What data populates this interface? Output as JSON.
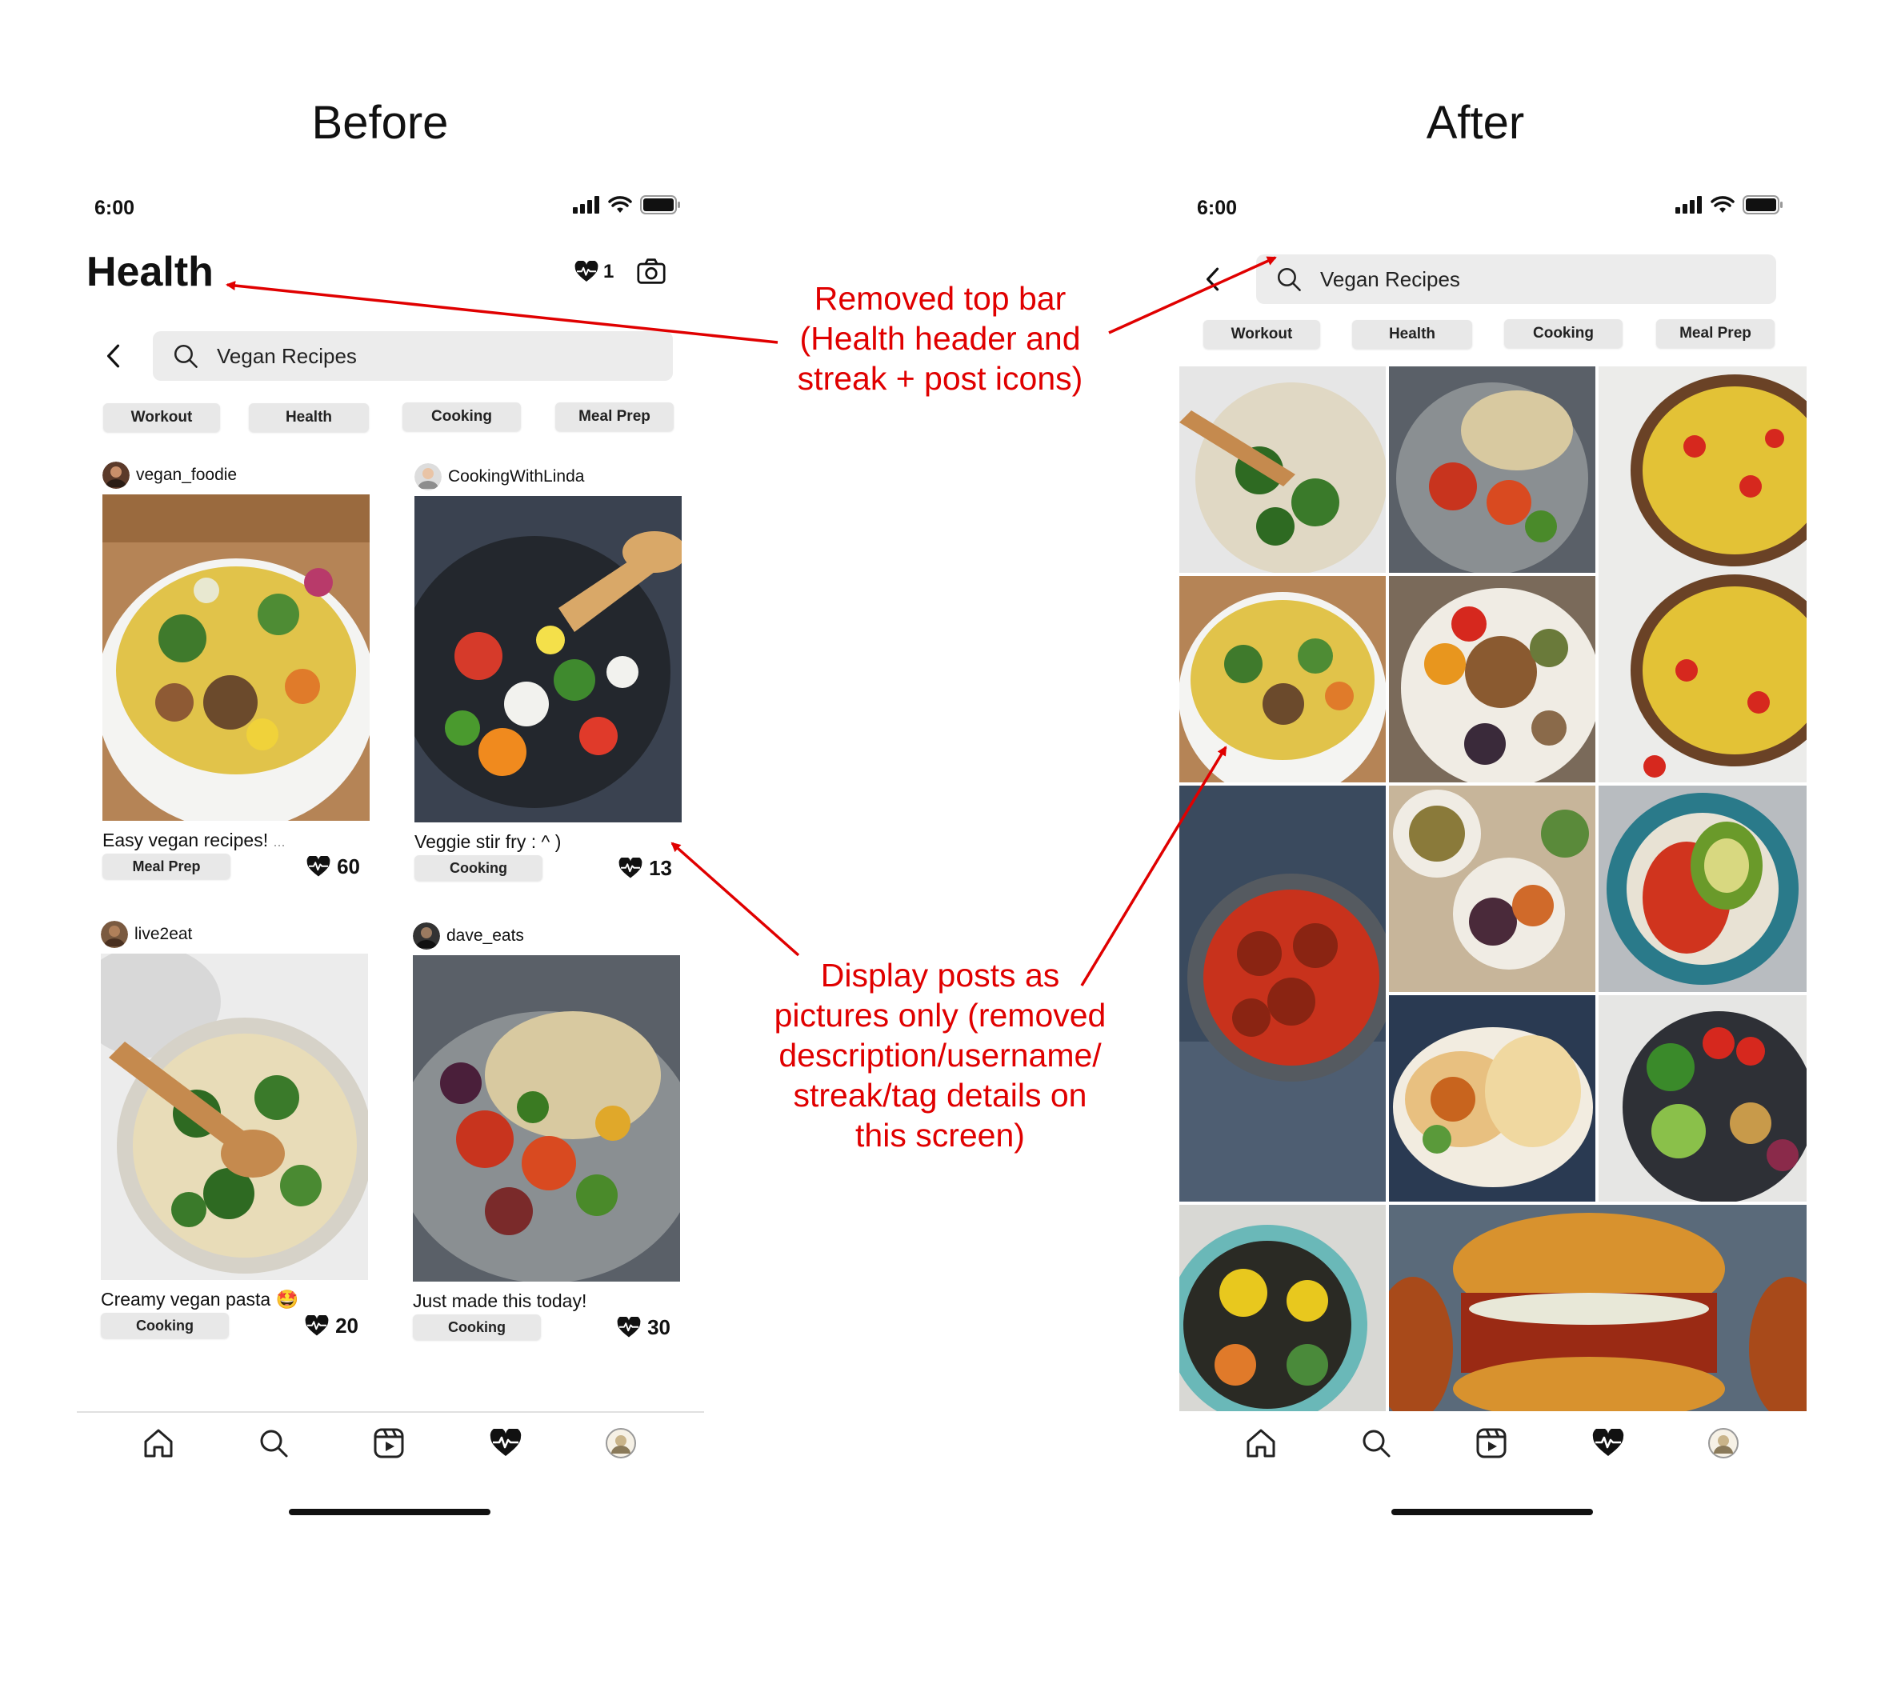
{
  "before": {
    "title": "Before",
    "time": "6:00",
    "header": {
      "title": "Health",
      "streak_count": "1"
    },
    "search": {
      "value": "Vegan Recipes"
    },
    "chips": [
      "Workout",
      "Health",
      "Cooking",
      "Meal Prep"
    ],
    "posts": [
      {
        "username": "vegan_foodie",
        "caption": "Easy vegan recipes!",
        "caption_more": "...",
        "tag": "Meal Prep",
        "likes": "60"
      },
      {
        "username": "CookingWithLinda",
        "caption": "Veggie stir fry : ^ )",
        "caption_more": "",
        "tag": "Cooking",
        "likes": "13"
      },
      {
        "username": "live2eat",
        "caption": "Creamy vegan pasta",
        "caption_more": "",
        "tag": "Cooking",
        "likes": "20"
      },
      {
        "username": "dave_eats",
        "caption": "Just made this today!",
        "caption_more": "",
        "tag": "Cooking",
        "likes": "30"
      }
    ]
  },
  "after": {
    "title": "After",
    "time": "6:00",
    "search": {
      "value": "Vegan Recipes"
    },
    "chips": [
      "Workout",
      "Health",
      "Cooking",
      "Meal Prep"
    ]
  },
  "annotations": {
    "top": [
      "Removed top bar",
      "(Health header and",
      "streak + post icons)"
    ],
    "bottom": [
      "Display posts as",
      "pictures only (removed",
      "description/username/",
      "streak/tag details on",
      "this screen)"
    ]
  },
  "colors": {
    "annotation": "#e00000",
    "chip_bg": "#e8e8e8",
    "search_bg": "#ececec"
  },
  "icons": {
    "status": [
      "signal-icon",
      "wifi-icon",
      "battery-icon"
    ],
    "header": [
      "heart-streak-icon",
      "camera-icon"
    ],
    "nav": [
      "home-icon",
      "search-icon",
      "reels-icon",
      "heart-pulse-icon",
      "profile-avatar-icon"
    ]
  }
}
